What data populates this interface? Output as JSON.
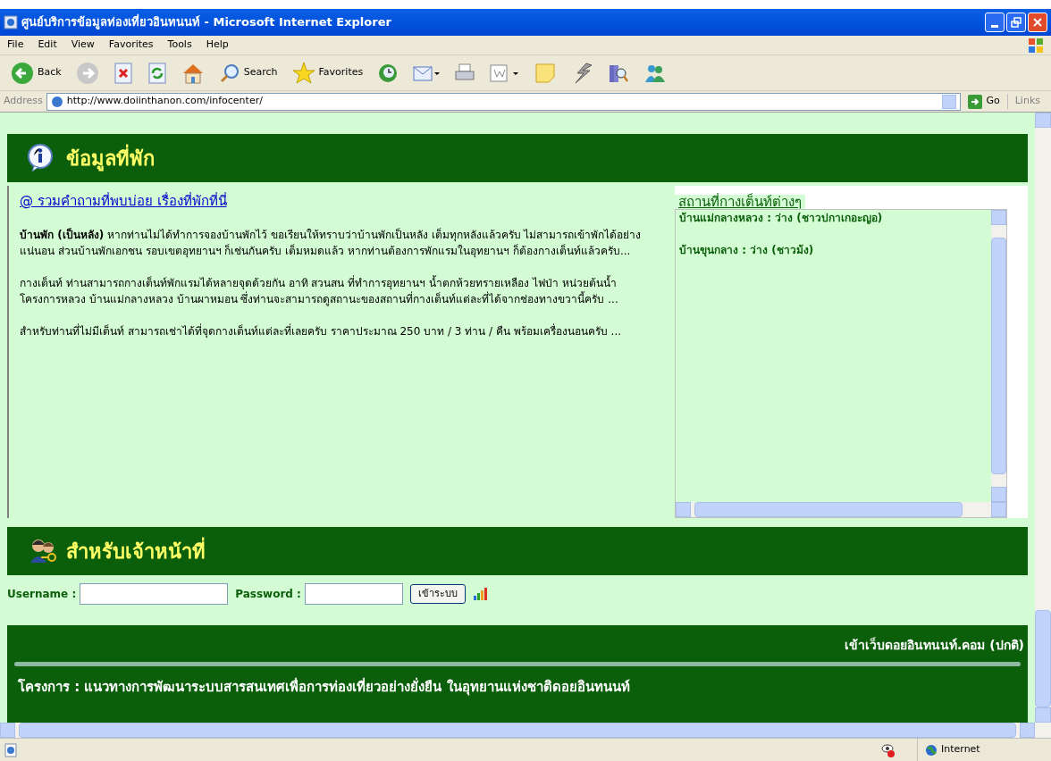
{
  "window": {
    "title": "ศูนย์บริการข้อมูลท่องเที่ยวอินทนนท์ - Microsoft Internet Explorer"
  },
  "menu": [
    "File",
    "Edit",
    "View",
    "Favorites",
    "Tools",
    "Help"
  ],
  "toolbar": [
    {
      "kind": "back",
      "label": "Back"
    },
    {
      "kind": "forward"
    },
    {
      "kind": "stop"
    },
    {
      "kind": "refresh"
    },
    {
      "kind": "home"
    },
    {
      "kind": "search",
      "label": "Search"
    },
    {
      "kind": "favorites",
      "label": "Favorites"
    },
    {
      "kind": "history"
    },
    {
      "kind": "mail"
    },
    {
      "kind": "print"
    },
    {
      "kind": "edit"
    },
    {
      "kind": "note"
    },
    {
      "kind": "flash"
    },
    {
      "kind": "research"
    },
    {
      "kind": "messenger"
    }
  ],
  "address_bar": {
    "label": "Address",
    "url": "http://www.doiinthanon.com/infocenter/",
    "go": "Go",
    "links": "Links"
  },
  "accommodation": {
    "title": "ข้อมูลที่พัก",
    "faq_link": "@ รวมคำถามที่พบบ่อย เรื่องที่พักที่นี่",
    "paragraphs": [
      "**บ้านพัก (เป็นหลัง)** หากท่านไม่ได้ทำการจองบ้านพักไว้ ขอเรียนให้ทราบว่าบ้านพักเป็นหลัง เต็มทุกหลังแล้วครับ ไม่สามารถเข้าพักได้อย่างแน่นอน ส่วนบ้านพักเอกชน รอบเขตอุทยานฯ ก็เช่นกันครับ เต็มหมดแล้ว หากท่านต้องการพักแรมในอุทยานฯ ก็ต้องกางเต็นท์แล้วครับ...",
      "กางเต็นท์ ท่านสามารถกางเต็นท์พักแรมได้หลายจุดด้วยกัน อาทิ สวนสน ที่ทำการอุทยานฯ น้ำตกห้วยทรายเหลือง ไฟป่า หน่วยต้นน้ำ โครงการหลวง บ้านแม่กลางหลวง บ้านผาหมอน ซึ่งท่านจะสามารถดูสถานะของสถานที่กางเต็นท์แต่ละที่ได้จากช่องทางขวานี้ครับ ...",
      "สำหรับท่านที่ไม่มีเต็นท์ สามารถเช่าได้ที่จุดกางเต็นท์แต่ละที่เลยครับ ราคาประมาณ 250 บาท / 3 ท่าน / คืน พร้อมเครื่องนอนครับ ..."
    ],
    "campsites": {
      "title": "สถานที่กางเต็นท์ต่างๆ",
      "items": [
        "บ้านแม่กลางหลวง : ว่าง (ชาวปกาเกอะญอ)",
        "บ้านขุนกลาง : ว่าง (ชาวม้ง)"
      ]
    }
  },
  "staff": {
    "title": "สำหรับเจ้าหน้าที่",
    "username_label": "Username :",
    "password_label": "Password :",
    "login_button": "เข้าระบบ"
  },
  "footer": {
    "link": "เข้าเว็บดอยอินทนนท์.คอม (ปกติ)",
    "project": "โครงการ : แนวทางการพัฒนาระบบสารสนเทศเพื่อการท่องเที่ยวอย่างยั่งยืน ในอุทยานแห่งชาติดอยอินทนนท์"
  },
  "status_bar": {
    "zone": "Internet"
  }
}
